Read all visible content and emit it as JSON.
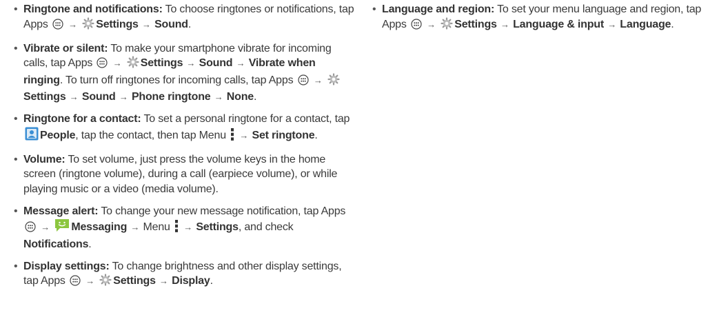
{
  "common": {
    "arrow": "→",
    "apps": "Apps",
    "settings": "Settings",
    "sound": "Sound",
    "menu": "Menu",
    "comma": ",",
    "period": "."
  },
  "icons": {
    "apps": "apps-icon",
    "settings": "settings-gear-icon",
    "people": "people-app-icon",
    "messaging": "messaging-app-icon",
    "menu": "menu-dots-icon"
  },
  "colors": {
    "text": "#3a3a3a",
    "people_icon": "#3b8fd4",
    "messaging_icon": "#8cc63f"
  },
  "items": {
    "ringtone": {
      "term": "Ringtone and notifications:",
      "t1": "To choose ringtones or notifications, tap"
    },
    "vibrate": {
      "term": "Vibrate or silent:",
      "t1": "To make your smartphone vibrate for incoming calls, tap",
      "vwr": "Vibrate when ringing",
      "t2": ". To turn off ringtones for incoming calls, tap",
      "phone_ringtone": "Phone ringtone",
      "none": "None"
    },
    "contact": {
      "term": "Ringtone for a contact:",
      "t1": "To set a personal ringtone for a contact, tap",
      "people": "People",
      "t2": ", tap the contact, then tap Menu",
      "set_ringtone": "Set ringtone"
    },
    "volume": {
      "term": "Volume:",
      "t1": "To set volume, just press the volume keys in the home screen (ringtone volume), during a call (earpiece volume), or while playing music or a video (media volume)."
    },
    "message": {
      "term": "Message alert:",
      "t1": "To change your new message notification, tap",
      "messaging": "Messaging",
      "t2": ", and check",
      "notifications": "Notifications"
    },
    "display": {
      "term": "Display settings:",
      "t1": "To change brightness and other display settings, tap",
      "display": "Display"
    },
    "language": {
      "term": "Language and region:",
      "t1": "To set your menu language and region, tap",
      "lang_input": "Language & input",
      "language": "Language"
    }
  }
}
